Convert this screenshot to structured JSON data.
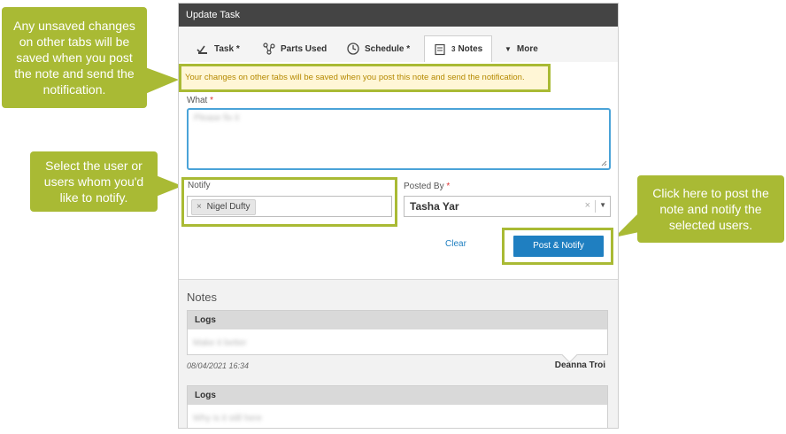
{
  "dialog": {
    "title": "Update Task"
  },
  "tabs": [
    {
      "label": "Task *",
      "icon": "task-check-icon"
    },
    {
      "label": "Parts Used",
      "icon": "parts-icon"
    },
    {
      "label": "Schedule *",
      "icon": "clock-icon"
    },
    {
      "label": "Notes",
      "badge": "3",
      "icon": "notes-icon"
    },
    {
      "label": "More",
      "icon": "triangle-down-icon"
    }
  ],
  "banner": "Your changes on other tabs will be saved when you post this note and send the notification.",
  "form": {
    "what_label": "What",
    "what_value": "Please fix it",
    "notify_label": "Notify",
    "notify_chip": "Nigel Dufty",
    "posted_by_label": "Posted By",
    "posted_by_value": "Tasha Yar",
    "required_mark": "*",
    "clear_label": "Clear",
    "post_button": "Post & Notify"
  },
  "notes": {
    "title": "Notes",
    "entries": [
      {
        "header": "Logs",
        "text": "Make it better",
        "date": "08/04/2021 16:34",
        "author": "Deanna Troi"
      },
      {
        "header": "Logs",
        "text": "Why is it still here"
      }
    ]
  },
  "callouts": {
    "tabs_warning": "Any unsaved changes on other tabs will be saved when you post the note and send the notification.",
    "notify_hint": "Select the user or users whom you'd like to notify.",
    "post_hint": "Click here to post the note and notify the selected users."
  },
  "colors": {
    "callout": "#a9ba34",
    "button": "#1f7fc1",
    "titlebar": "#444444",
    "banner_text": "#b58900"
  }
}
